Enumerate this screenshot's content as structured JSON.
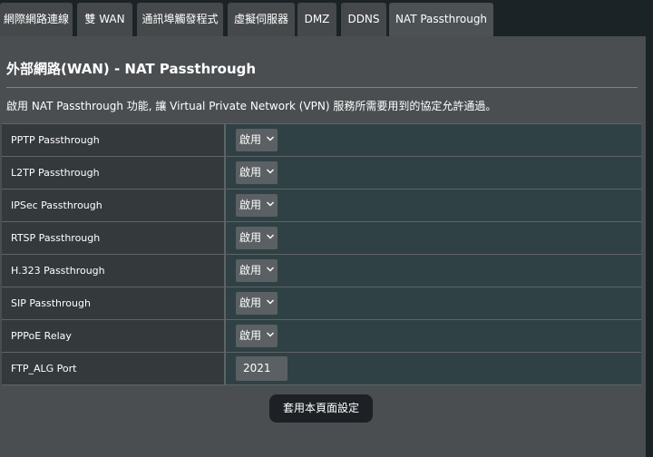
{
  "tabs": [
    {
      "label": "網際網路連線"
    },
    {
      "label": "雙 WAN"
    },
    {
      "label": "通訊埠觸發程式"
    },
    {
      "label": "虛擬伺服器"
    },
    {
      "label": "DMZ"
    },
    {
      "label": "DDNS"
    },
    {
      "label": "NAT Passthrough"
    }
  ],
  "page": {
    "title": "外部網路(WAN) - NAT Passthrough",
    "description": "啟用 NAT Passthrough 功能, 讓 Virtual Private Network (VPN) 服務所需要用到的協定允許通過。"
  },
  "rows": [
    {
      "label": "PPTP Passthrough",
      "value": "啟用"
    },
    {
      "label": "L2TP Passthrough",
      "value": "啟用"
    },
    {
      "label": "IPSec Passthrough",
      "value": "啟用"
    },
    {
      "label": "RTSP Passthrough",
      "value": "啟用"
    },
    {
      "label": "H.323 Passthrough",
      "value": "啟用"
    },
    {
      "label": "SIP Passthrough",
      "value": "啟用"
    },
    {
      "label": "PPPoE Relay",
      "value": "啟用"
    },
    {
      "label": "FTP_ALG Port",
      "value": "2021"
    }
  ],
  "apply_button": {
    "label": "套用本頁面設定"
  },
  "colors": {
    "background": "#1c2326",
    "panel": "#4a4e51",
    "value_cell": "#2f4145",
    "label_cell": "#34393c"
  }
}
